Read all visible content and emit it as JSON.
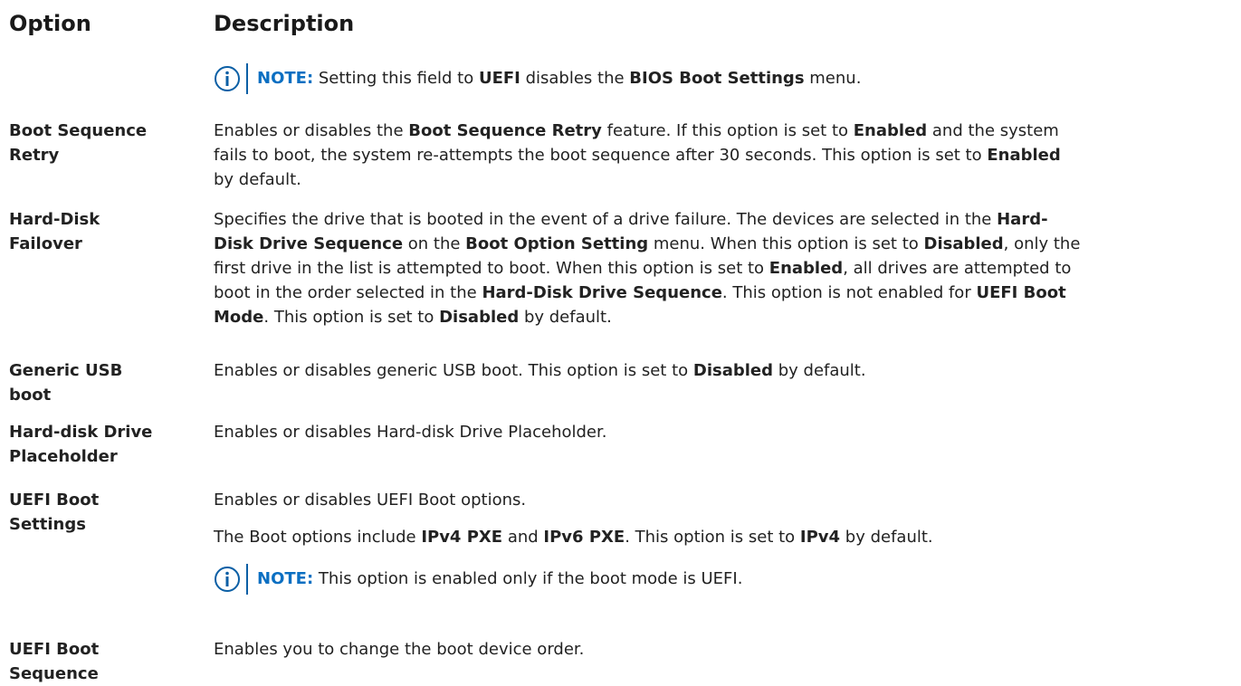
{
  "headers": {
    "option": "Option",
    "description": "Description"
  },
  "top_note": {
    "label": "NOTE:",
    "parts": [
      "Setting this field to ",
      "UEFI",
      " disables the ",
      "BIOS Boot Settings",
      " menu."
    ]
  },
  "rows": [
    {
      "option": [
        "Boot Sequence",
        "Retry"
      ],
      "desc": [
        [
          "Enables or disables the ",
          "Boot Sequence Retry",
          " feature. If this option is set to ",
          "Enabled",
          " and the system"
        ],
        [
          "fails to boot, the system re-attempts the boot sequence after 30 seconds. This option is set to ",
          "Enabled"
        ],
        [
          "by default."
        ]
      ]
    },
    {
      "option": [
        "Hard-Disk",
        "Failover"
      ],
      "desc": [
        [
          "Specifies the drive that is booted in the event of a drive failure. The devices are selected in the ",
          "Hard-"
        ],
        [
          "Disk Drive Sequence",
          " on the ",
          "Boot Option Setting",
          " menu. When this option is set to ",
          "Disabled",
          ", only the"
        ],
        [
          "first drive in the list is attempted to boot. When this option is set to ",
          "Enabled",
          ", all drives are attempted to"
        ],
        [
          "boot in the order selected in the ",
          "Hard-Disk Drive Sequence",
          ". This option is not enabled for ",
          "UEFI Boot"
        ],
        [
          "Mode",
          ". This option is set to ",
          "Disabled",
          " by default."
        ]
      ]
    },
    {
      "option": [
        "Generic USB",
        "boot"
      ],
      "desc": [
        [
          "Enables or disables generic USB boot. This option is set to ",
          "Disabled",
          " by default."
        ]
      ]
    },
    {
      "option": [
        "Hard-disk Drive",
        "Placeholder"
      ],
      "desc": [
        [
          "Enables or disables Hard-disk Drive Placeholder."
        ]
      ]
    },
    {
      "option": [
        "UEFI Boot",
        "Settings"
      ],
      "desc": [
        [
          "Enables or disables UEFI Boot options."
        ]
      ],
      "desc2": [
        [
          "The Boot options include ",
          "IPv4 PXE",
          " and ",
          "IPv6 PXE",
          ". This option is set to ",
          "IPv4",
          " by default."
        ]
      ],
      "note": {
        "label": "NOTE:",
        "parts": [
          "This option is enabled only if the boot mode is UEFI."
        ]
      }
    },
    {
      "option": [
        "UEFI Boot",
        "Sequence"
      ],
      "desc": [
        [
          "Enables you to change the boot device order."
        ]
      ]
    }
  ],
  "colors": {
    "note_accent": "#0b6fc2",
    "text": "#222222"
  }
}
